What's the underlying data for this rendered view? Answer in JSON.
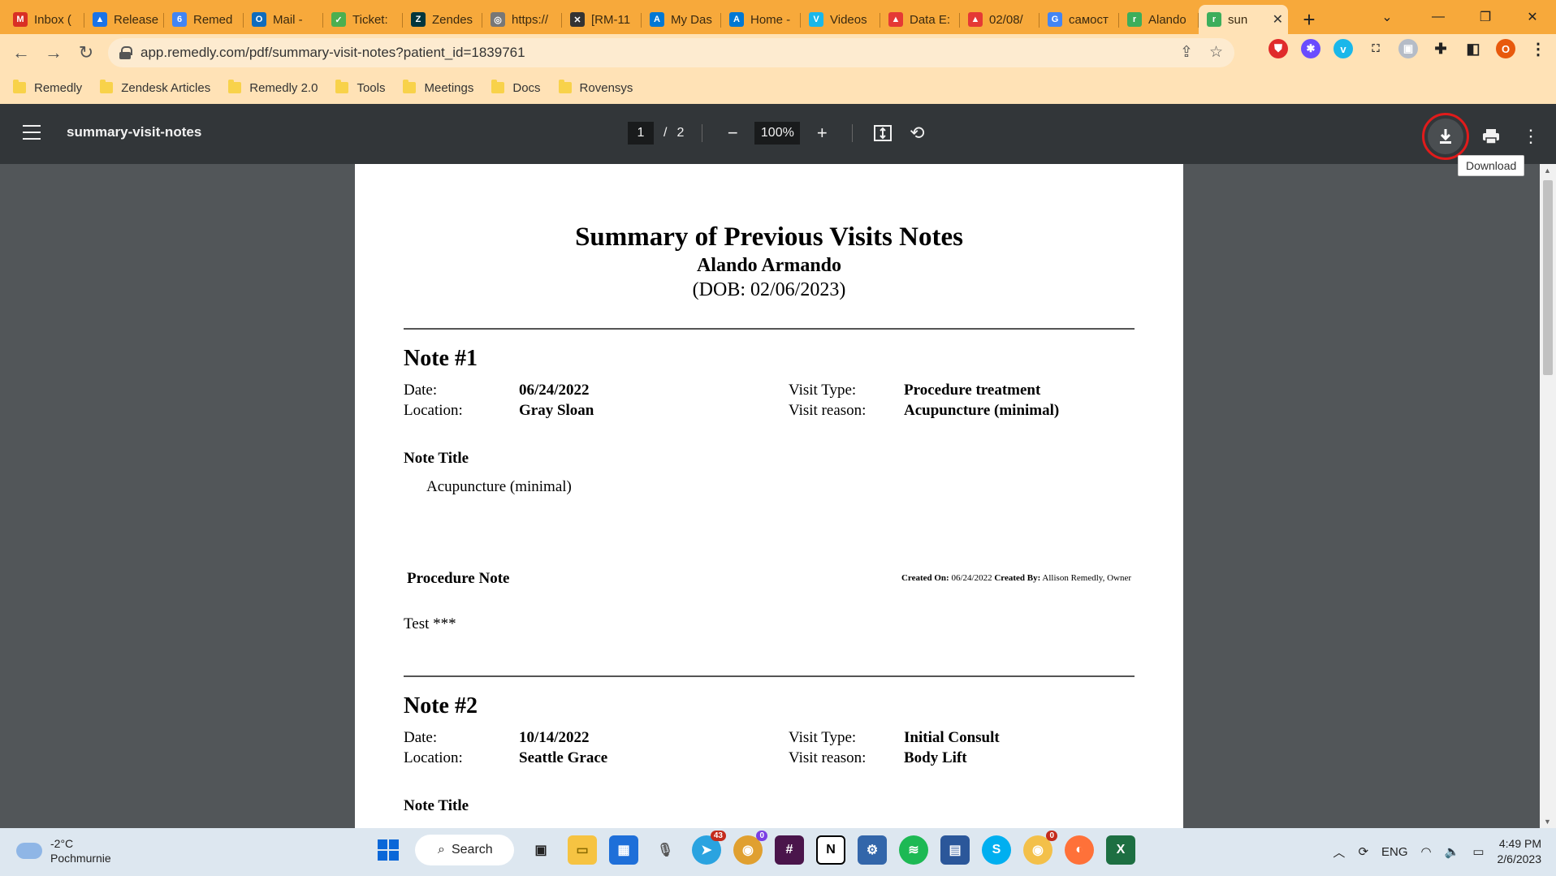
{
  "tabs": [
    {
      "label": "Inbox (",
      "icon": "gmail-icon",
      "color": "#d93025",
      "glyph": "M"
    },
    {
      "label": "Release",
      "icon": "drive-icon",
      "color": "#1a73e8",
      "glyph": "▲"
    },
    {
      "label": "Remed",
      "icon": "calendar-icon",
      "color": "#4285f4",
      "glyph": "6"
    },
    {
      "label": "Mail - ",
      "icon": "outlook-icon",
      "color": "#0f6cbd",
      "glyph": "O"
    },
    {
      "label": "Ticket:",
      "icon": "ticket-icon",
      "color": "#4caf50",
      "glyph": "✓"
    },
    {
      "label": "Zendes",
      "icon": "zendesk-icon",
      "color": "#03363d",
      "glyph": "Z"
    },
    {
      "label": "https://",
      "icon": "globe-icon",
      "color": "#777777",
      "glyph": "◎"
    },
    {
      "label": "[RM-11",
      "icon": "jira-icon",
      "color": "#333333",
      "glyph": "✕"
    },
    {
      "label": "My Das",
      "icon": "azure-icon",
      "color": "#0078d4",
      "glyph": "A"
    },
    {
      "label": "Home -",
      "icon": "azure-icon",
      "color": "#0078d4",
      "glyph": "A"
    },
    {
      "label": "Videos",
      "icon": "vimeo-icon",
      "color": "#1ab7ea",
      "glyph": "V"
    },
    {
      "label": "Data E:",
      "icon": "triangle-icon",
      "color": "#e53935",
      "glyph": "▲"
    },
    {
      "label": "02/08/",
      "icon": "triangle-icon",
      "color": "#e53935",
      "glyph": "▲"
    },
    {
      "label": "самост",
      "icon": "google-icon",
      "color": "#4285f4",
      "glyph": "G"
    },
    {
      "label": "Alando",
      "icon": "remedly-icon",
      "color": "#3cae5b",
      "glyph": "r"
    },
    {
      "label": "sun",
      "icon": "remedly-icon",
      "color": "#3cae5b",
      "glyph": "r",
      "active": true
    }
  ],
  "address": {
    "url": "app.remedly.com/pdf/summary-visit-notes?patient_id=1839761"
  },
  "bookmarks": [
    "Remedly",
    "Zendesk Articles",
    "Remedly 2.0",
    "Tools",
    "Meetings",
    "Docs",
    "Rovensys"
  ],
  "profile_initial": "O",
  "pdf": {
    "title": "summary-visit-notes",
    "page_current": "1",
    "page_separator": "/",
    "page_total": "2",
    "zoom": "100%",
    "tooltip": "Download"
  },
  "document": {
    "title": "Summary of Previous Visits Notes",
    "patient": "Alando Armando",
    "dob": "(DOB: 02/06/2023)",
    "notes": [
      {
        "heading": "Note #1",
        "date_label": "Date:",
        "date": "06/24/2022",
        "location_label": "Location:",
        "location": "Gray Sloan",
        "visit_type_label": "Visit Type:",
        "visit_type": "Procedure treatment",
        "visit_reason_label": "Visit reason:",
        "visit_reason": "Acupuncture (minimal)",
        "note_title_label": "Note Title",
        "note_title": "Acupuncture (minimal)",
        "procedure_label": "Procedure Note",
        "created_on_label": "Created On:",
        "created_on": "06/24/2022",
        "created_by_label": "Created By:",
        "created_by": "Allison Remedly, Owner",
        "body": "Test ***"
      },
      {
        "heading": "Note #2",
        "date_label": "Date:",
        "date": "10/14/2022",
        "location_label": "Location:",
        "location": "Seattle Grace",
        "visit_type_label": "Visit Type:",
        "visit_type": "Initial Consult",
        "visit_reason_label": "Visit reason:",
        "visit_reason": "Body Lift",
        "note_title_label": "Note Title"
      }
    ]
  },
  "taskbar": {
    "temperature": "-2°C",
    "weather": "Pochmurnie",
    "search_label": "Search",
    "language": "ENG",
    "time": "4:49 PM",
    "date": "2/6/2023",
    "telegram_badge": "43",
    "chrome_badge": "0",
    "chrome2_badge": "0"
  }
}
